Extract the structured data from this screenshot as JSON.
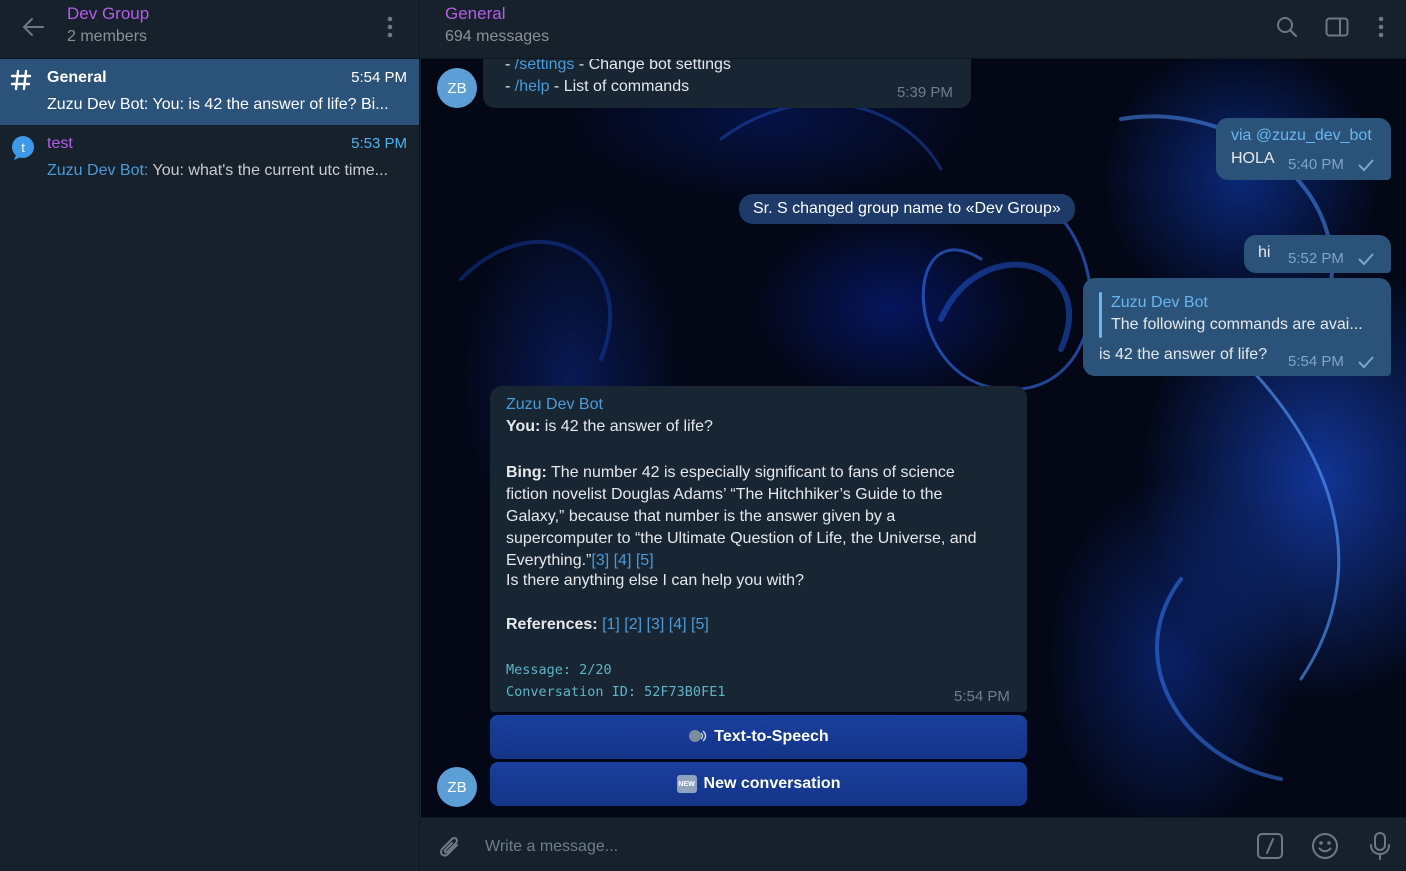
{
  "left_header": {
    "title": "Dev Group",
    "subtitle": "2 members"
  },
  "chats": [
    {
      "name": "General",
      "time": "5:54 PM",
      "preview": "Zuzu Dev Bot: You: is 42 the answer of life?  Bi..."
    },
    {
      "name": "test",
      "time": "5:53 PM",
      "preview_sender": "Zuzu Dev Bot:",
      "preview": " You: what's the current utc time...",
      "avatar_letter": "t"
    }
  ],
  "chat_header": {
    "title": "General",
    "subtitle": "694 messages"
  },
  "messages": {
    "cmd_prefix_1": "- ",
    "cmd_settings": "/settings",
    "cmd_settings_desc": " - Change bot settings",
    "cmd_prefix_2": "- ",
    "cmd_help": "/help",
    "cmd_help_desc": " - List of commands",
    "cmd_time": "5:39 PM",
    "avatar_initials": "ZB",
    "via_text": "via @zuzu_dev_bot",
    "hola_text": "HOLA",
    "hola_time": "5:40 PM",
    "service_text": "Sr. S changed group name to «Dev Group»",
    "hi_text": "hi",
    "hi_time": "5:52 PM",
    "reply_author": "Zuzu Dev Bot",
    "reply_quote": "The following commands are avai...",
    "reply_text": "is 42 the answer of life?",
    "reply_time": "5:54 PM",
    "bot_name": "Zuzu Dev Bot",
    "you_label": "You:",
    "you_text": " is 42 the answer of life?",
    "bing_label": "Bing:",
    "bing_text": " The number 42 is especially significant to fans of science fiction novelist Douglas Adams’ “The Hitchhiker’s Guide to the Galaxy,” because that number is the answer given by a supercomputer to “the Ultimate Question of Life, the Universe, and Everything.”",
    "bing_refs_inline": "[3] [4] [5]",
    "followup": "Is there anything else I can help you with?",
    "references_label": "References:",
    "references": "[1] [2] [3] [4] [5]",
    "message_count": "Message: 2/20",
    "conversation_id": "Conversation ID: 52F73B0FE1",
    "bot_time": "5:54 PM"
  },
  "keyboard": {
    "tts_label": "Text-to-Speech",
    "new_label": "New conversation",
    "new_badge": "NEW"
  },
  "composer": {
    "placeholder": "Write a message..."
  },
  "colors": {
    "accent_purple": "#b45de8",
    "link_blue": "#4b9bd8",
    "active_chat": "#2b5278",
    "outgoing_bubble": "#2b5278",
    "incoming_bubble": "#182533",
    "panel": "#17212b"
  }
}
